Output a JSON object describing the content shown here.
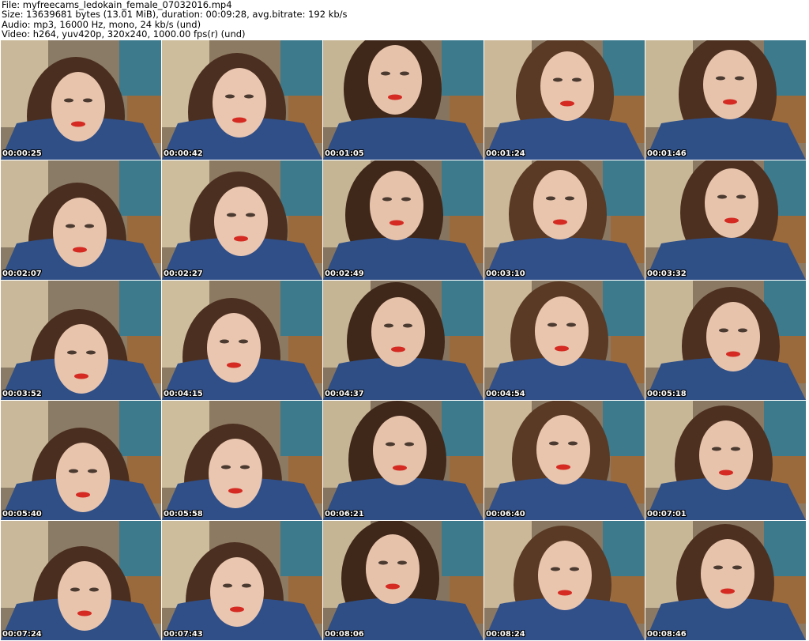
{
  "header": {
    "line1": "File: myfreecams_ledokain_female_07032016.mp4",
    "line2": "Size: 13639681 bytes (13.01 MiB), duration: 00:09:28, avg.bitrate: 192 kb/s",
    "line3": "Audio: mp3, 16000 Hz, mono, 24 kb/s (und)",
    "line4": "Video: h264, yuv420p, 320x240, 1000.00 fps(r) (und)"
  },
  "thumbnails": [
    {
      "time": "00:00:25"
    },
    {
      "time": "00:00:42"
    },
    {
      "time": "00:01:05"
    },
    {
      "time": "00:01:24"
    },
    {
      "time": "00:01:46"
    },
    {
      "time": "00:02:07"
    },
    {
      "time": "00:02:27"
    },
    {
      "time": "00:02:49"
    },
    {
      "time": "00:03:10"
    },
    {
      "time": "00:03:32"
    },
    {
      "time": "00:03:52"
    },
    {
      "time": "00:04:15"
    },
    {
      "time": "00:04:37"
    },
    {
      "time": "00:04:54"
    },
    {
      "time": "00:05:18"
    },
    {
      "time": "00:05:40"
    },
    {
      "time": "00:05:58"
    },
    {
      "time": "00:06:21"
    },
    {
      "time": "00:06:40"
    },
    {
      "time": "00:07:01"
    },
    {
      "time": "00:07:24"
    },
    {
      "time": "00:07:43"
    },
    {
      "time": "00:08:06"
    },
    {
      "time": "00:08:24"
    },
    {
      "time": "00:08:46"
    }
  ]
}
